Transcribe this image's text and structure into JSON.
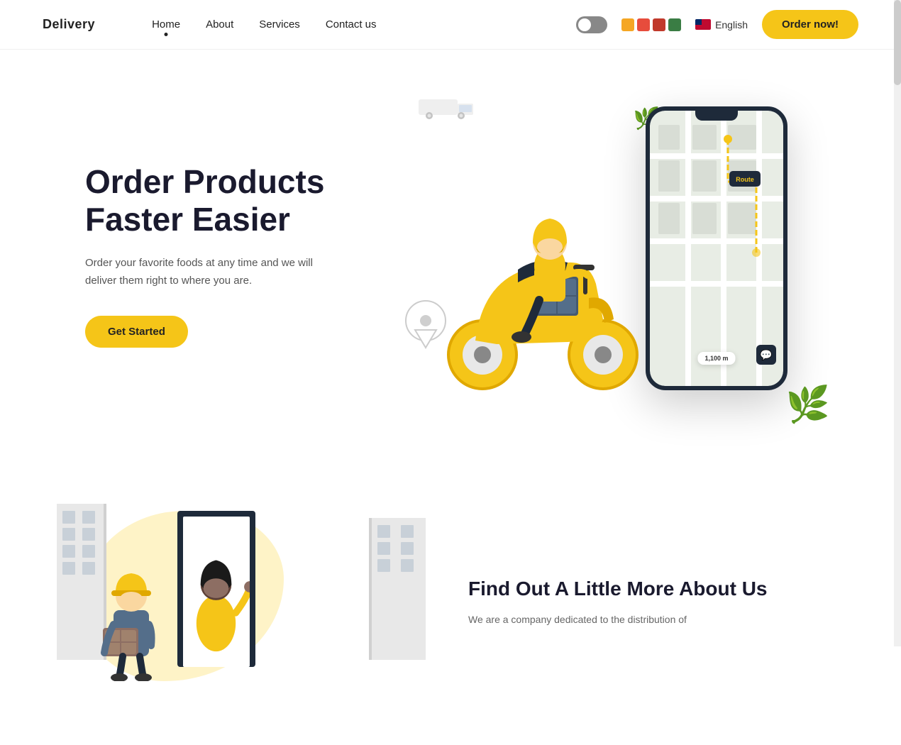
{
  "nav": {
    "logo": "Delivery",
    "links": [
      {
        "label": "Home",
        "active": true
      },
      {
        "label": "About",
        "active": false
      },
      {
        "label": "Services",
        "active": false
      },
      {
        "label": "Contact us",
        "active": false
      }
    ],
    "lang": "English",
    "order_btn": "Order now!"
  },
  "hero": {
    "title": "Order Products Faster Easier",
    "subtitle": "Order your favorite foods at any time and we will deliver them right to where you are.",
    "cta": "Get Started",
    "map_distance": "1,100 m"
  },
  "section2": {
    "title": "Find Out A Little More About Us",
    "desc": "We are a company dedicated to the distribution of"
  },
  "colors": {
    "accent": "#f5c518",
    "swatch1": "#f5a623",
    "swatch2": "#e74c3c",
    "swatch3": "#3a7d44",
    "dark": "#1e2a3a",
    "text": "#1a1a2e"
  }
}
